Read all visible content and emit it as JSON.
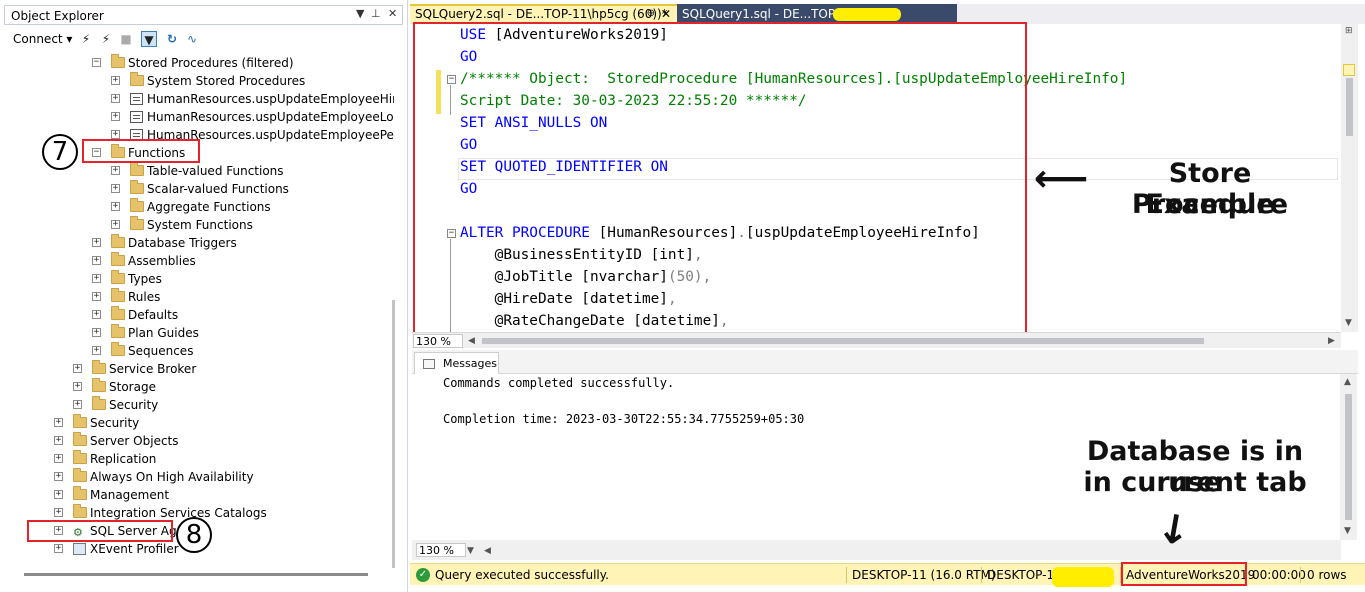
{
  "object_explorer": {
    "title": "Object Explorer",
    "title_controls": {
      "dropdown": "▼",
      "pin": "⊥",
      "close": "✕"
    },
    "toolbar": {
      "connect_label": "Connect ▾"
    },
    "tree": [
      {
        "label": "Stored Procedures (filtered)",
        "icon": "folder-icon",
        "exp": "−"
      },
      {
        "label": "System Stored Procedures",
        "icon": "folder-icon",
        "exp": "+"
      },
      {
        "label": "HumanResources.uspUpdateEmployeeHireIn",
        "icon": "stored-procedure-icon",
        "exp": "+"
      },
      {
        "label": "HumanResources.uspUpdateEmployeeLogin",
        "icon": "stored-procedure-icon",
        "exp": "+"
      },
      {
        "label": "HumanResources.uspUpdateEmployeePersor",
        "icon": "stored-procedure-icon",
        "exp": "+"
      },
      {
        "label": "Functions",
        "icon": "folder-icon",
        "exp": "−"
      },
      {
        "label": "Table-valued Functions",
        "icon": "folder-icon",
        "exp": "+"
      },
      {
        "label": "Scalar-valued Functions",
        "icon": "folder-icon",
        "exp": "+"
      },
      {
        "label": "Aggregate Functions",
        "icon": "folder-icon",
        "exp": "+"
      },
      {
        "label": "System Functions",
        "icon": "folder-icon",
        "exp": "+"
      },
      {
        "label": "Database Triggers",
        "icon": "folder-icon",
        "exp": "+"
      },
      {
        "label": "Assemblies",
        "icon": "folder-icon",
        "exp": "+"
      },
      {
        "label": "Types",
        "icon": "folder-icon",
        "exp": "+"
      },
      {
        "label": "Rules",
        "icon": "folder-icon",
        "exp": "+"
      },
      {
        "label": "Defaults",
        "icon": "folder-icon",
        "exp": "+"
      },
      {
        "label": "Plan Guides",
        "icon": "folder-icon",
        "exp": "+"
      },
      {
        "label": "Sequences",
        "icon": "folder-icon",
        "exp": "+"
      },
      {
        "label": "Service Broker",
        "icon": "folder-icon",
        "exp": "+"
      },
      {
        "label": "Storage",
        "icon": "folder-icon",
        "exp": "+"
      },
      {
        "label": "Security",
        "icon": "folder-icon",
        "exp": "+"
      },
      {
        "label": "Security",
        "icon": "folder-icon",
        "exp": "+"
      },
      {
        "label": "Server Objects",
        "icon": "folder-icon",
        "exp": "+"
      },
      {
        "label": "Replication",
        "icon": "folder-icon",
        "exp": "+"
      },
      {
        "label": "Always On High Availability",
        "icon": "folder-icon",
        "exp": "+"
      },
      {
        "label": "Management",
        "icon": "folder-icon",
        "exp": "+"
      },
      {
        "label": "Integration Services Catalogs",
        "icon": "folder-icon",
        "exp": "+"
      },
      {
        "label": "SQL Server Agent",
        "icon": "sql-agent-icon",
        "exp": "+"
      },
      {
        "label": "XEvent Profiler",
        "icon": "xevent-icon",
        "exp": "+"
      }
    ],
    "marker_7": "⑦",
    "marker_8": "⑧"
  },
  "tabs": {
    "active": {
      "label": "SQLQuery2.sql - DE...TOP-11\\hp5cg (60))*",
      "pin": "⊕",
      "close": "✕"
    },
    "inactive": {
      "label": "SQLQuery1.sql - DE...TOP-11"
    }
  },
  "editor": {
    "lines": [
      [
        {
          "c": "kw",
          "t": "USE "
        },
        {
          "c": "id",
          "t": "[AdventureWorks2019]"
        }
      ],
      [
        {
          "c": "kw",
          "t": "GO"
        }
      ],
      [
        {
          "c": "cm",
          "t": "/****** Object:  StoredProcedure [HumanResources].[uspUpdateEmployeeHireInfo]"
        }
      ],
      [
        {
          "c": "cm",
          "t": "Script Date: 30-03-2023 22:55:20 ******/"
        }
      ],
      [
        {
          "c": "kw",
          "t": "SET ANSI_NULLS ON"
        }
      ],
      [
        {
          "c": "kw",
          "t": "GO"
        }
      ],
      [
        {
          "c": "kw",
          "t": "SET QUOTED_IDENTIFIER ON"
        }
      ],
      [
        {
          "c": "kw",
          "t": "GO"
        }
      ],
      [
        {
          "c": "id",
          "t": ""
        }
      ],
      [
        {
          "c": "kw",
          "t": "ALTER PROCEDURE "
        },
        {
          "c": "id",
          "t": "[HumanResources]"
        },
        {
          "c": "pu",
          "t": "."
        },
        {
          "c": "id",
          "t": "[uspUpdateEmployeeHireInfo]"
        }
      ],
      [
        {
          "c": "id",
          "t": "    @BusinessEntityID "
        },
        {
          "c": "id",
          "t": "[int]"
        },
        {
          "c": "pu",
          "t": ","
        }
      ],
      [
        {
          "c": "id",
          "t": "    @JobTitle "
        },
        {
          "c": "id",
          "t": "[nvarchar]"
        },
        {
          "c": "pu",
          "t": "(50),"
        }
      ],
      [
        {
          "c": "id",
          "t": "    @HireDate "
        },
        {
          "c": "id",
          "t": "[datetime]"
        },
        {
          "c": "pu",
          "t": ","
        }
      ],
      [
        {
          "c": "id",
          "t": "    @RateChangeDate "
        },
        {
          "c": "id",
          "t": "[datetime]"
        },
        {
          "c": "pu",
          "t": ","
        }
      ]
    ],
    "zoom": "130 %"
  },
  "annotation_store": {
    "line1": "Store Procedure",
    "line2": "Example",
    "arrow": "⟵"
  },
  "messages": {
    "tab_label": "Messages",
    "lines": [
      "Commands completed successfully.",
      "",
      "Completion time: 2023-03-30T22:55:34.7755259+05:30"
    ],
    "zoom": "130 %"
  },
  "annotation_db": {
    "line1": "Database is in use",
    "line2": "in currrent tab",
    "arrow": "↓"
  },
  "status": {
    "message": "Query executed successfully.",
    "server": "DESKTOP-11 (16.0 RTM)",
    "user": "DESKTOP-11",
    "database": "AdventureWorks2019",
    "elapsed": "00:00:00",
    "rows": "0 rows"
  },
  "colors": {
    "keyword": "#0000ff",
    "comment": "#008000",
    "status_bar": "#fff3b5",
    "annotation_red": "#e3242b",
    "redact_yellow": "#ffee00"
  }
}
